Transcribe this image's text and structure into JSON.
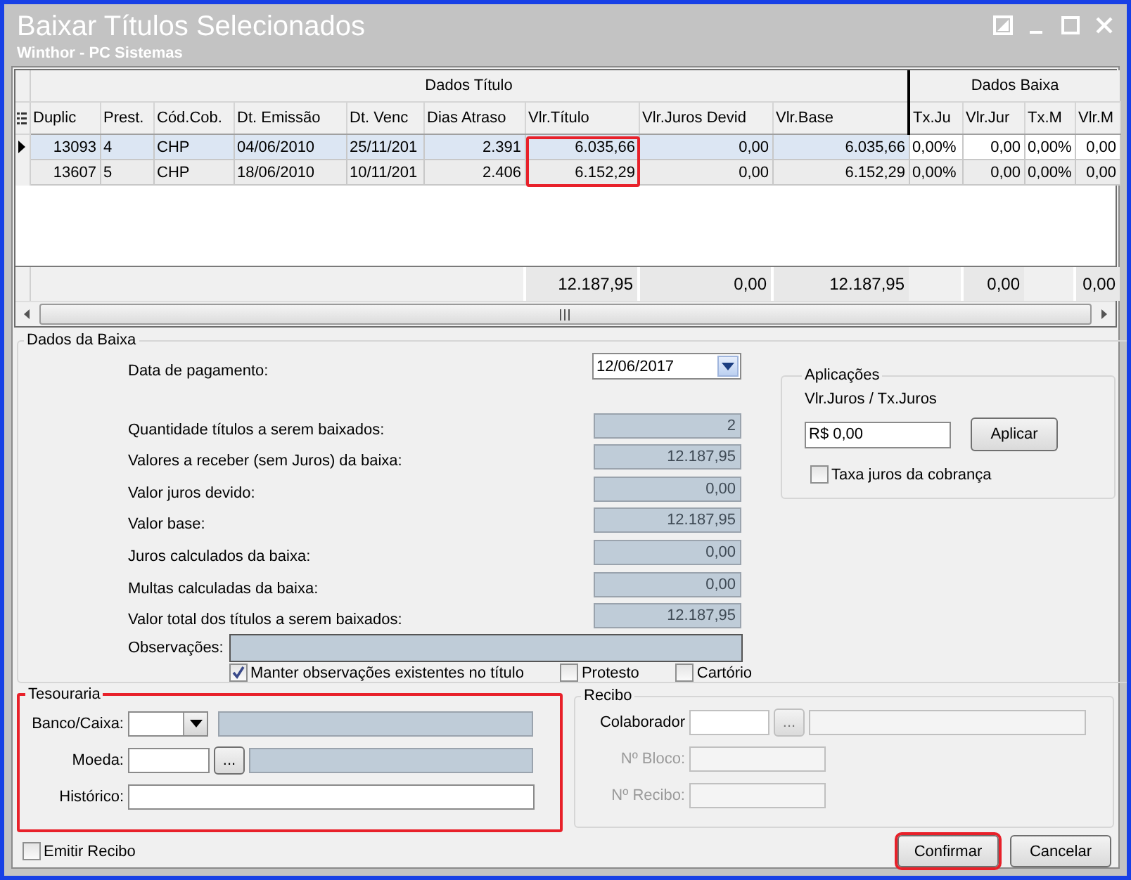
{
  "window": {
    "title": "Baixar Títulos Selecionados",
    "subtitle": "Winthor - PC Sistemas"
  },
  "grid": {
    "groups": [
      {
        "label": "Dados Título",
        "columns": [
          {
            "label": "Duplic",
            "highlighted": false
          },
          {
            "label": "Prest.",
            "highlighted": false
          },
          {
            "label": "Cód.Cob.",
            "highlighted": false
          },
          {
            "label": "Dt. Emissão",
            "highlighted": false
          },
          {
            "label": "Dt. Venc",
            "highlighted": false
          },
          {
            "label": "Dias Atraso",
            "highlighted": false
          },
          {
            "label": "Vlr.Título",
            "highlighted": true,
            "total": "12.187,95"
          },
          {
            "label": "Vlr.Juros Devid",
            "highlighted": false,
            "total": "0,00"
          },
          {
            "label": "Vlr.Base",
            "highlighted": false,
            "total": "12.187,95"
          }
        ]
      },
      {
        "label": "Dados Baixa",
        "columns": [
          {
            "label": "Tx.Ju",
            "highlighted": false
          },
          {
            "label": "Vlr.Jur",
            "highlighted": false,
            "total": "0,00"
          },
          {
            "label": "Tx.M",
            "highlighted": false
          },
          {
            "label": "Vlr.M",
            "highlighted": false,
            "total": "0,00"
          }
        ]
      }
    ],
    "rows": [
      {
        "selected": true,
        "cells": [
          "13093",
          "4",
          "CHP",
          "04/06/2010",
          "25/11/201",
          "2.391",
          "6.035,66",
          "0,00",
          "6.035,66",
          "0,00%",
          "0,00",
          "0,00%",
          "0,00"
        ]
      },
      {
        "selected": false,
        "cells": [
          "13607",
          "5",
          "CHP",
          "18/06/2010",
          "10/11/201",
          "2.406",
          "6.152,29",
          "0,00",
          "6.152,29",
          "0,00%",
          "0,00",
          "0,00%",
          "0,00"
        ]
      }
    ]
  },
  "payment": {
    "legend": "Dados da Baixa",
    "date_label": "Data de pagamento:",
    "date_value": "12/06/2017",
    "summary": [
      {
        "label": "Quantidade títulos a serem baixados:",
        "value": "2"
      },
      {
        "label": "Valores a receber (sem Juros) da baixa:",
        "value": "12.187,95"
      },
      {
        "label": "Valor juros devido:",
        "value": "0,00"
      },
      {
        "label": "Valor base:",
        "value": "12.187,95"
      },
      {
        "label": "Juros calculados da baixa:",
        "value": "0,00"
      },
      {
        "label": "Multas calculadas da baixa:",
        "value": "0,00"
      },
      {
        "label": "Valor total dos títulos a serem baixados:",
        "value": "12.187,95"
      }
    ],
    "notes_label": "Observações:",
    "checks": [
      {
        "label": "Manter observações existentes no título",
        "checked": true
      },
      {
        "label": "Protesto",
        "checked": false
      },
      {
        "label": "Cartório",
        "checked": false
      }
    ]
  },
  "applications": {
    "legend": "Aplicações",
    "field_label": "Vlr.Juros / Tx.Juros",
    "value": "R$ 0,00",
    "button": "Aplicar",
    "check": {
      "label": "Taxa juros da cobrança",
      "checked": false
    }
  },
  "treasury": {
    "legend": "Tesouraria",
    "highlighted": true,
    "fields": [
      {
        "label": "Banco/Caixa:",
        "kind": "combo",
        "disabled": false
      },
      {
        "label": "Moeda:",
        "kind": "lookup",
        "button": "...",
        "disabled": false
      },
      {
        "label": "Histórico:",
        "kind": "text",
        "disabled": false
      }
    ]
  },
  "receipt": {
    "legend": "Recibo",
    "fields": [
      {
        "label": "Colaborador",
        "kind": "lookup",
        "button": "...",
        "disabled": false
      },
      {
        "label": "Nº Bloco:",
        "kind": "text",
        "disabled": true
      },
      {
        "label": "Nº Recibo:",
        "kind": "text",
        "disabled": true
      }
    ]
  },
  "footer": {
    "check": {
      "label": "Emitir Recibo",
      "checked": false
    },
    "buttons": [
      {
        "label": "Confirmar",
        "highlighted": true
      },
      {
        "label": "Cancelar",
        "highlighted": false
      }
    ]
  }
}
